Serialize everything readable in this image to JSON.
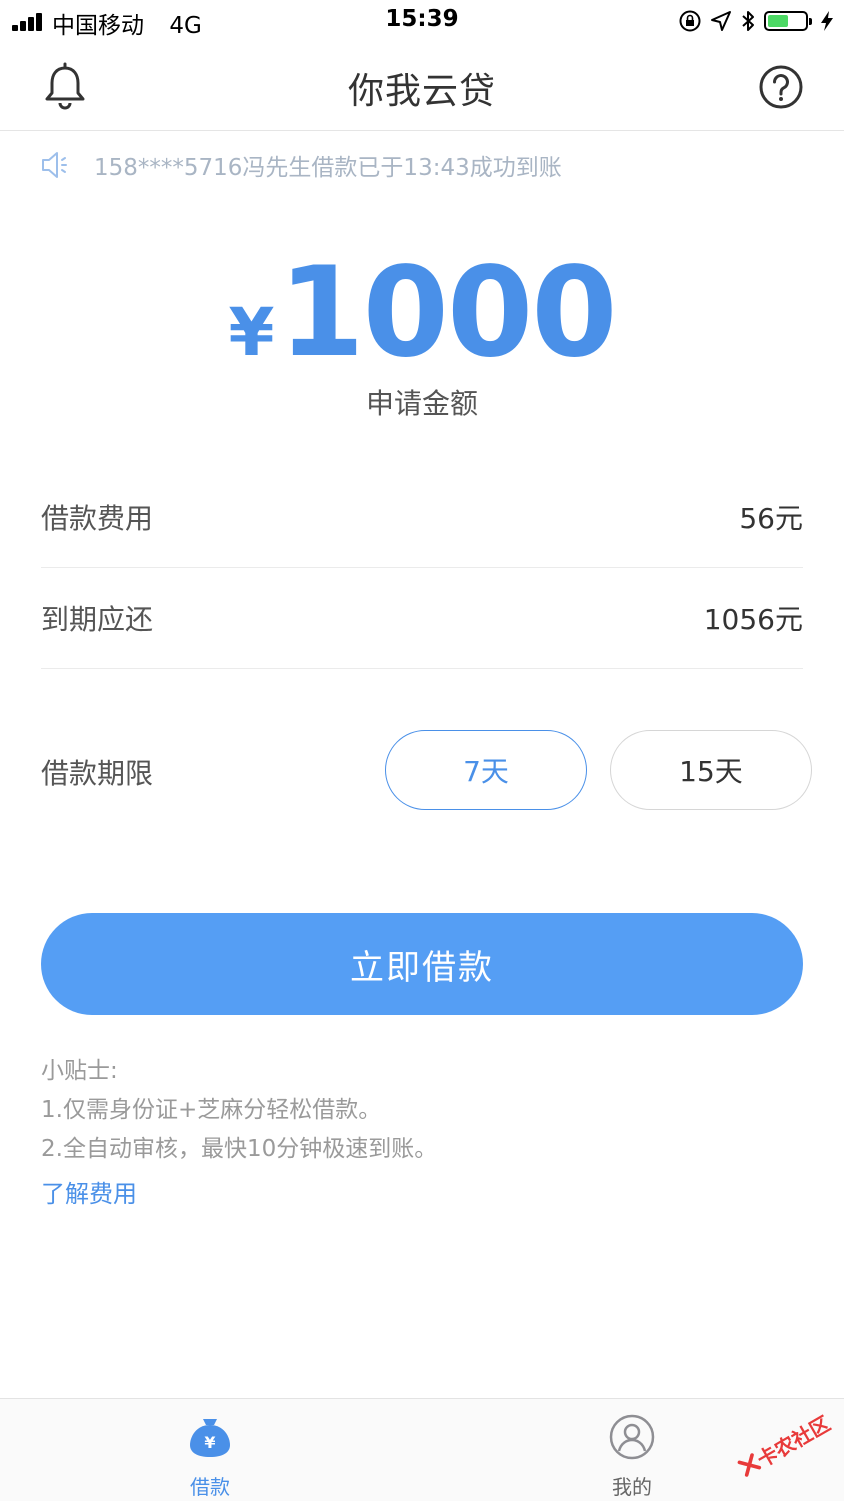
{
  "status_bar": {
    "carrier": "中国移动",
    "network": "4G",
    "time": "15:39",
    "battery_level": 0.55
  },
  "nav": {
    "title": "你我云贷",
    "left_icon": "bell-icon",
    "right_icon": "help-icon"
  },
  "notice": {
    "icon": "speaker-icon",
    "text": "158****5716冯先生借款已于13:43成功到账"
  },
  "amount": {
    "currency": "¥",
    "value": "1000",
    "label": "申请金额"
  },
  "fee_row": {
    "label": "借款费用",
    "value": "56元"
  },
  "due_row": {
    "label": "到期应还",
    "value": "1056元"
  },
  "term": {
    "label": "借款期限",
    "options": [
      {
        "label": "7天",
        "selected": true
      },
      {
        "label": "15天",
        "selected": false
      }
    ]
  },
  "primary_button": {
    "label": "立即借款"
  },
  "tips": {
    "title": "小贴士:",
    "lines": [
      "1.仅需身份证+芝麻分轻松借款。",
      "2.全自动审核，最快10分钟极速到账。"
    ],
    "link": "了解费用"
  },
  "tabbar": {
    "items": [
      {
        "label": "借款",
        "icon": "money-bag-icon",
        "active": true
      },
      {
        "label": "我的",
        "icon": "user-icon",
        "active": false
      }
    ]
  },
  "watermark": {
    "text": "卡农社区"
  },
  "colors": {
    "accent": "#4a90e8",
    "button": "#559ef4",
    "muted": "#a9b5c4"
  }
}
